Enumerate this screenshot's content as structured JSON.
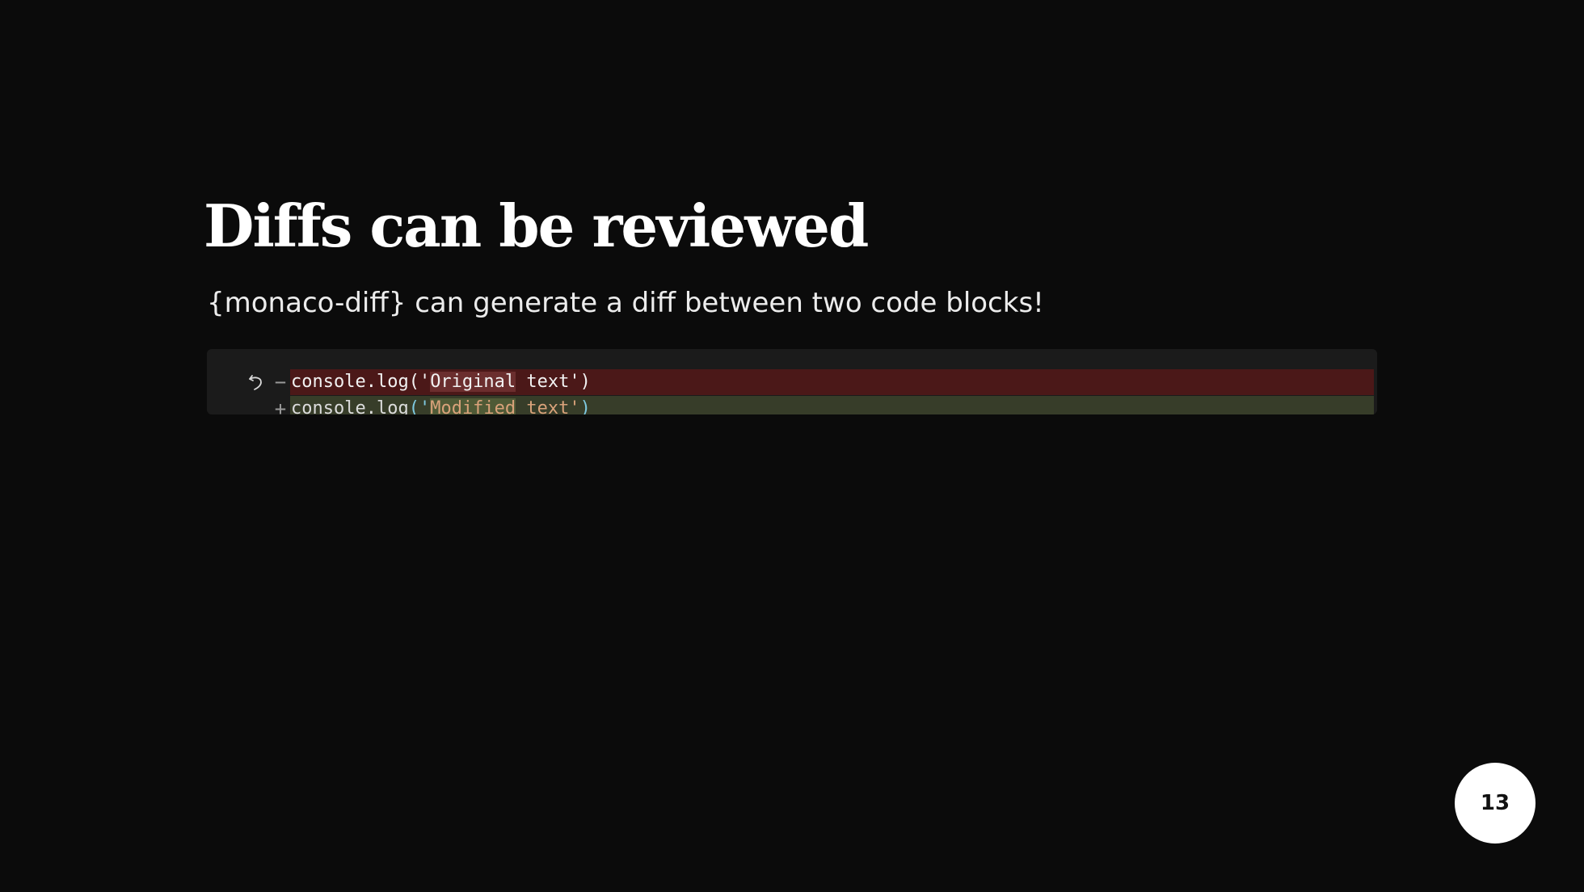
{
  "slide": {
    "title": "Diffs can be reviewed",
    "subtitle": "{monaco-diff} can generate a diff between two code blocks!",
    "page_number": "13"
  },
  "diff": {
    "removed_line": {
      "sign": "−",
      "code_prefix": "console.log('",
      "changed_word": "Original",
      "code_suffix": " text')"
    },
    "added_line": {
      "sign": "+",
      "code_obj": "console.log",
      "code_open": "('",
      "changed_word": "Modified",
      "code_suffix": " text'",
      "code_close": ")"
    },
    "revert_icon": "revert-arrow-icon"
  },
  "colors": {
    "background": "#0b0b0b",
    "editor_background": "#1b1b1b",
    "removed_line": "#4b1818",
    "added_line": "#373d29",
    "badge": "#ffffff"
  }
}
